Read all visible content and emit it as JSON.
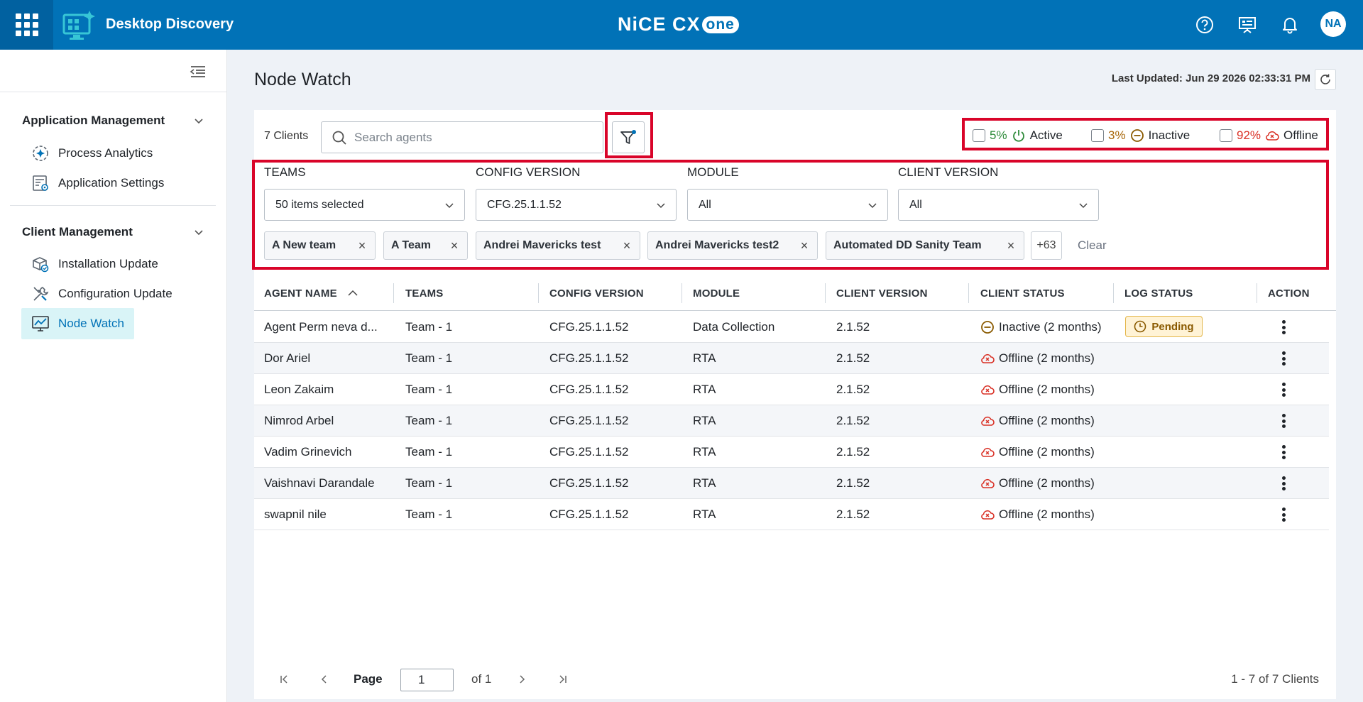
{
  "header": {
    "app_title": "Desktop Discovery",
    "logo_text": "NiCE CX",
    "logo_pill": "one",
    "user_initials": "NA",
    "brand_color": "#0172b7"
  },
  "sidebar": {
    "sections": [
      {
        "title": "Application Management",
        "items": [
          {
            "label": "Process Analytics",
            "icon": "process-analytics-icon"
          },
          {
            "label": "Application Settings",
            "icon": "application-settings-icon"
          }
        ]
      },
      {
        "title": "Client Management",
        "items": [
          {
            "label": "Installation Update",
            "icon": "installation-update-icon"
          },
          {
            "label": "Configuration Update",
            "icon": "configuration-update-icon"
          },
          {
            "label": "Node Watch",
            "icon": "node-watch-icon",
            "active": true
          }
        ]
      }
    ]
  },
  "main": {
    "page_title": "Node Watch",
    "last_updated": "Last Updated: Jun 29 2026 02:33:31 PM",
    "clients_count": "7 Clients",
    "search_placeholder": "Search agents",
    "status_filters": [
      {
        "percent": "5%",
        "label": "Active",
        "color": "#2e8b3a"
      },
      {
        "percent": "3%",
        "label": "Inactive",
        "color": "#a8670a"
      },
      {
        "percent": "92%",
        "label": "Offline",
        "color": "#d93025"
      }
    ],
    "filters": {
      "teams": {
        "label": "TEAMS",
        "value": "50 items selected"
      },
      "config_version": {
        "label": "CONFIG VERSION",
        "value": "CFG.25.1.1.52"
      },
      "module": {
        "label": "MODULE",
        "value": "All"
      },
      "client_version": {
        "label": "CLIENT VERSION",
        "value": "All"
      }
    },
    "chips": [
      "A New team",
      "A Team",
      "Andrei Mavericks test",
      "Andrei Mavericks test2",
      "Automated DD Sanity Team"
    ],
    "more_chips": "+63",
    "clear_label": "Clear"
  },
  "table": {
    "columns": [
      "AGENT NAME",
      "TEAMS",
      "CONFIG VERSION",
      "MODULE",
      "CLIENT VERSION",
      "CLIENT STATUS",
      "LOG STATUS",
      "ACTION"
    ],
    "rows": [
      {
        "agent": "Agent Perm neva d...",
        "team": "Team - 1",
        "config": "CFG.25.1.1.52",
        "module": "Data Collection",
        "client_version": "2.1.52",
        "status": "Inactive (2 months)",
        "status_type": "inactive",
        "log_status": "Pending"
      },
      {
        "agent": "Dor Ariel",
        "team": "Team - 1",
        "config": "CFG.25.1.1.52",
        "module": "RTA",
        "client_version": "2.1.52",
        "status": "Offline (2 months)",
        "status_type": "offline",
        "log_status": ""
      },
      {
        "agent": "Leon Zakaim",
        "team": "Team - 1",
        "config": "CFG.25.1.1.52",
        "module": "RTA",
        "client_version": "2.1.52",
        "status": "Offline (2 months)",
        "status_type": "offline",
        "log_status": ""
      },
      {
        "agent": "Nimrod Arbel",
        "team": "Team - 1",
        "config": "CFG.25.1.1.52",
        "module": "RTA",
        "client_version": "2.1.52",
        "status": "Offline (2 months)",
        "status_type": "offline",
        "log_status": ""
      },
      {
        "agent": "Vadim Grinevich",
        "team": "Team - 1",
        "config": "CFG.25.1.1.52",
        "module": "RTA",
        "client_version": "2.1.52",
        "status": "Offline (2 months)",
        "status_type": "offline",
        "log_status": ""
      },
      {
        "agent": "Vaishnavi Darandale",
        "team": "Team - 1",
        "config": "CFG.25.1.1.52",
        "module": "RTA",
        "client_version": "2.1.52",
        "status": "Offline (2 months)",
        "status_type": "offline",
        "log_status": ""
      },
      {
        "agent": "swapnil nile",
        "team": "Team - 1",
        "config": "CFG.25.1.1.52",
        "module": "RTA",
        "client_version": "2.1.52",
        "status": "Offline (2 months)",
        "status_type": "offline",
        "log_status": ""
      }
    ]
  },
  "pagination": {
    "page_label": "Page",
    "current_page": "1",
    "of_label": "of 1",
    "summary": "1 - 7 of 7 Clients"
  }
}
